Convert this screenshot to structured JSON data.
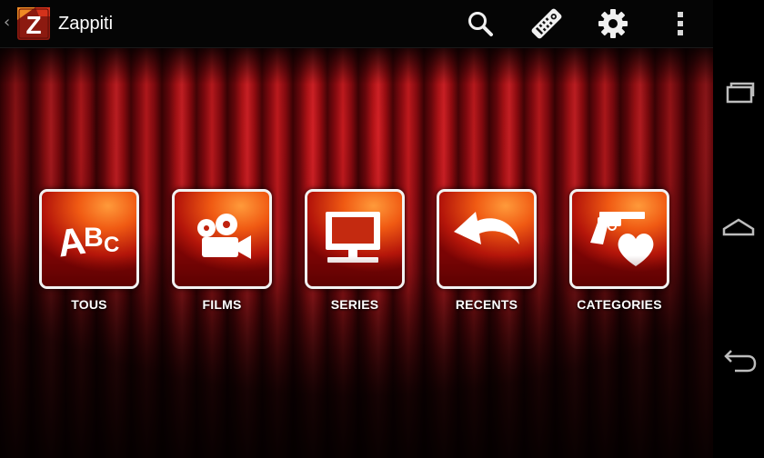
{
  "app": {
    "title": "Zappiti",
    "logo_letter": "Z"
  },
  "actionbar": {
    "icons": [
      "search-icon",
      "remote-control-icon",
      "gear-icon",
      "overflow-menu-icon"
    ]
  },
  "tiles": [
    {
      "label": "TOUS",
      "icon": "abc-letters-icon"
    },
    {
      "label": "FILMS",
      "icon": "movie-camera-icon"
    },
    {
      "label": "SERIES",
      "icon": "tv-monitor-icon"
    },
    {
      "label": "RECENTS",
      "icon": "curved-arrow-icon"
    },
    {
      "label": "CATEGORIES",
      "icon": "gun-and-heart-icon"
    }
  ],
  "tile_abc": {
    "a": "A",
    "b": "B",
    "c": "C"
  },
  "navbar": {
    "icons": [
      "recent-apps-icon",
      "home-icon",
      "back-icon"
    ]
  },
  "colors": {
    "actionbar_bg": "#050505",
    "curtain_red": "#c41a1e",
    "tile_orange": "#f05a13",
    "tile_border": "#f2f2f2",
    "text": "#ffffff"
  }
}
